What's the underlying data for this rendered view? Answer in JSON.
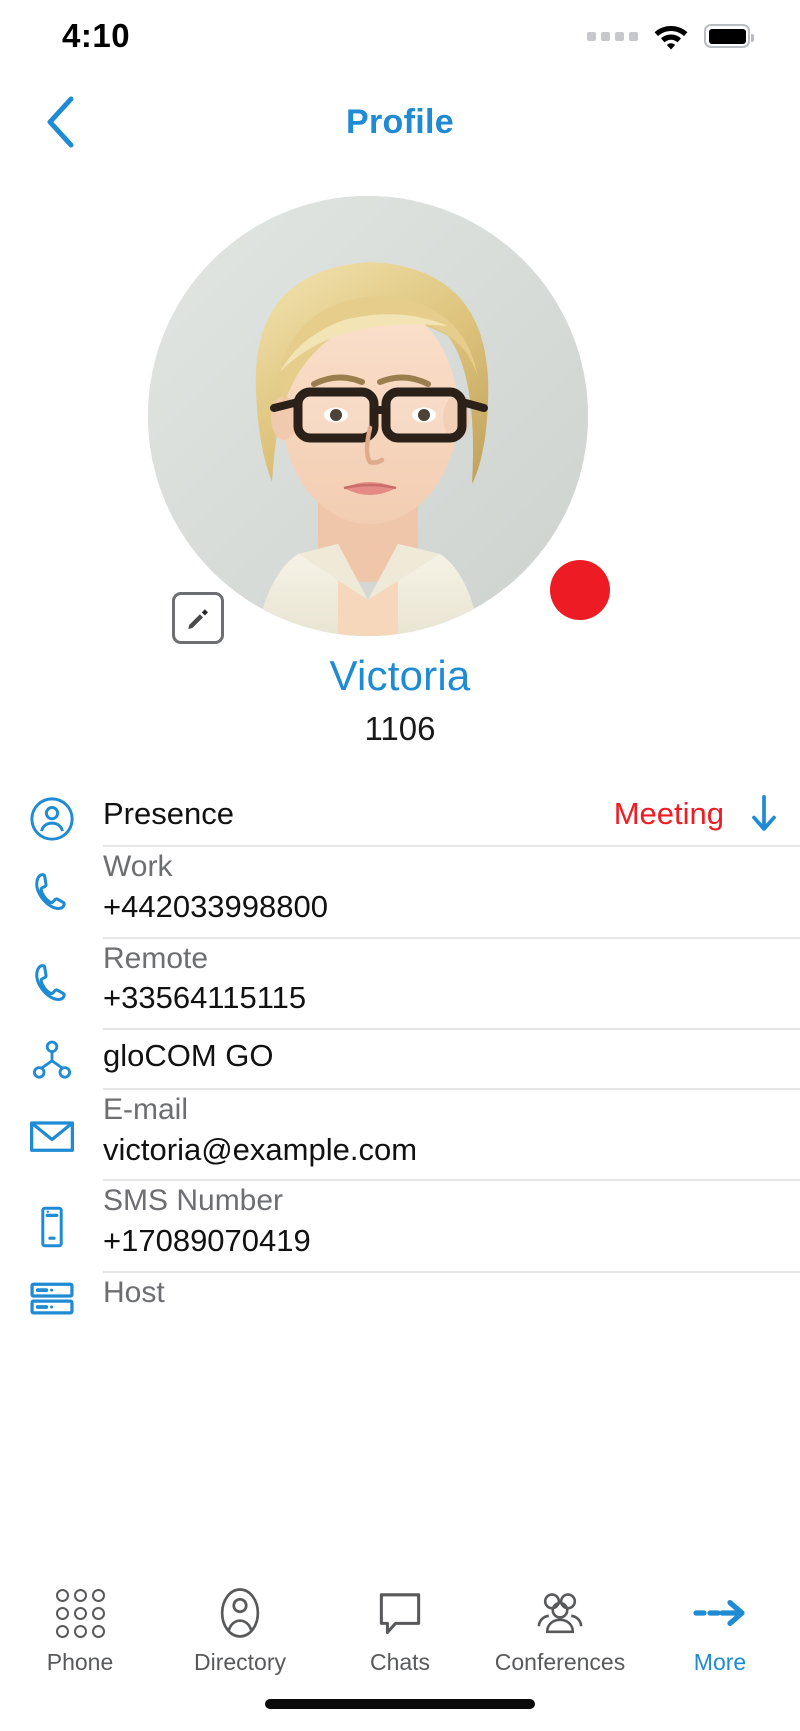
{
  "statusbar": {
    "time": "4:10",
    "signal_icon": "signal-dots-icon",
    "wifi_icon": "wifi-icon",
    "battery_icon": "battery-full-icon"
  },
  "navbar": {
    "back_icon": "chevron-left-icon",
    "title": "Profile",
    "accent_color": "#1e8bd4"
  },
  "profile": {
    "avatar_alt": "avatar-photo",
    "edit_icon": "pencil-edit-icon",
    "status_dot_color": "#ed1c24",
    "name": "Victoria",
    "extension": "1106"
  },
  "info": {
    "rows": [
      {
        "icon": "presence-person-icon",
        "label": "Presence",
        "value": "Meeting",
        "value_color": "#ee1d23",
        "trailing_icon": "arrow-down-icon",
        "type": "presence"
      },
      {
        "icon": "phone-handset-icon",
        "label": "Work",
        "value": "+442033998800",
        "type": "pair"
      },
      {
        "icon": "phone-handset-icon",
        "label": "Remote",
        "value": "+33564115115",
        "type": "pair"
      },
      {
        "icon": "network-nodes-icon",
        "label": "",
        "value": "gloCOM GO",
        "type": "single"
      },
      {
        "icon": "envelope-icon",
        "label": "E-mail",
        "value": "victoria@example.com",
        "type": "pair"
      },
      {
        "icon": "mobile-phone-icon",
        "label": "SMS Number",
        "value": "+17089070419",
        "type": "pair"
      },
      {
        "icon": "server-rack-icon",
        "label": "Host",
        "value": "",
        "type": "pair"
      }
    ]
  },
  "tabbar": {
    "items": [
      {
        "icon": "dialpad-icon",
        "label": "Phone",
        "active": false
      },
      {
        "icon": "person-oval-icon",
        "label": "Directory",
        "active": false
      },
      {
        "icon": "chat-bubble-icon",
        "label": "Chats",
        "active": false
      },
      {
        "icon": "people-group-icon",
        "label": "Conferences",
        "active": false
      },
      {
        "icon": "dashed-arrow-right-icon",
        "label": "More",
        "active": true
      }
    ],
    "active_color": "#1e8bd4",
    "inactive_color": "#58595b"
  }
}
